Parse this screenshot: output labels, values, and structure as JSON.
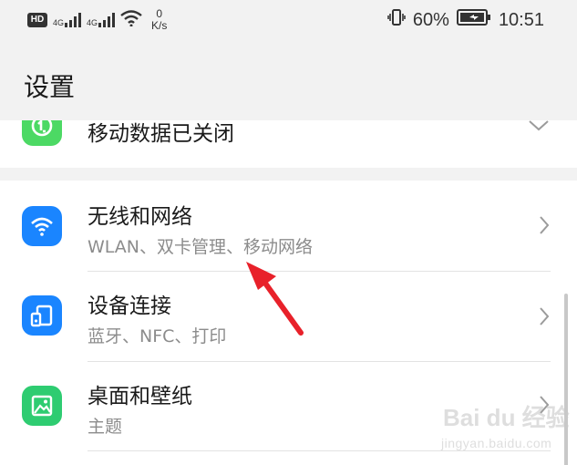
{
  "status_bar": {
    "hd_label": "HD",
    "sim1": "4G",
    "sim2": "4G",
    "speed_value": "0",
    "speed_unit": "K/s",
    "battery_percent": "60%",
    "time": "10:51"
  },
  "header": {
    "title": "设置"
  },
  "items": [
    {
      "title": "移动数据已关闭",
      "subtitle": "",
      "icon": "mobile-data-icon",
      "icon_color": "#4cd964"
    },
    {
      "title": "无线和网络",
      "subtitle": "WLAN、双卡管理、移动网络",
      "icon": "wifi-icon",
      "icon_color": "#1a85ff"
    },
    {
      "title": "设备连接",
      "subtitle": "蓝牙、NFC、打印",
      "icon": "device-connection-icon",
      "icon_color": "#1a85ff"
    },
    {
      "title": "桌面和壁纸",
      "subtitle": "主题",
      "icon": "wallpaper-icon",
      "icon_color": "#2ecc71"
    }
  ],
  "watermark": {
    "brand": "Bai du 经验",
    "url": "jingyan.baidu.com"
  },
  "colors": {
    "annotation_arrow": "#e8212a"
  }
}
